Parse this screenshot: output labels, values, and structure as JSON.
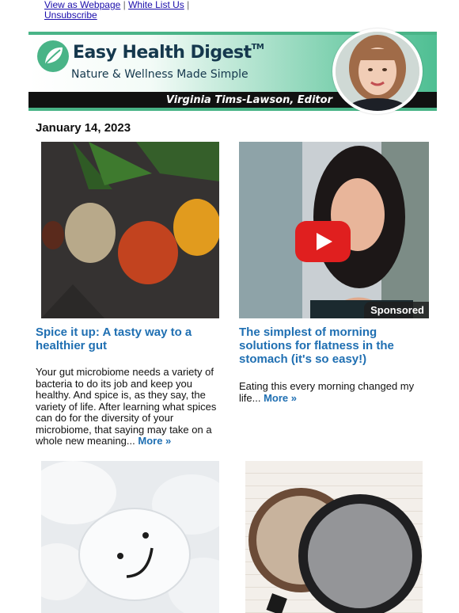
{
  "header_links": {
    "view_as_webpage": "View as Webpage",
    "separator1": "|",
    "white_list_us": "White List Us",
    "separator2": "|",
    "unsubscribe": "Unsubscribe"
  },
  "banner": {
    "brand_name": "Easy Health Digest",
    "trademark": "TM",
    "tagline": "Nature & Wellness Made Simple",
    "editor": "Virginia Tims-Lawson, Editor"
  },
  "date": "January 14, 2023",
  "articles": [
    {
      "image_desc": "spices-in-spoons",
      "title": "Spice it up: A tasty way to a healthier gut",
      "body": "Your gut microbiome needs a variety of bacteria to do its job and keep you healthy. And spice is, as they say, the variety of life. After learning what spices can do for the diversity of your microbiome, that saying may take on a whole new meaning...",
      "more": "More »"
    },
    {
      "image_desc": "video-thumbnail-woman",
      "badge": "Sponsored",
      "title": "The simplest of morning solutions for flatness in the stomach (it's so easy!)",
      "body": "Eating this every morning changed my life...",
      "more": "More »"
    }
  ],
  "colors": {
    "link_blue": "#1a0dab",
    "headline_blue": "#1f6fb2",
    "brand_green": "#49b487",
    "play_red": "#e01f1f"
  },
  "icons": {
    "logo": "leaf-icon",
    "video": "play-icon"
  }
}
